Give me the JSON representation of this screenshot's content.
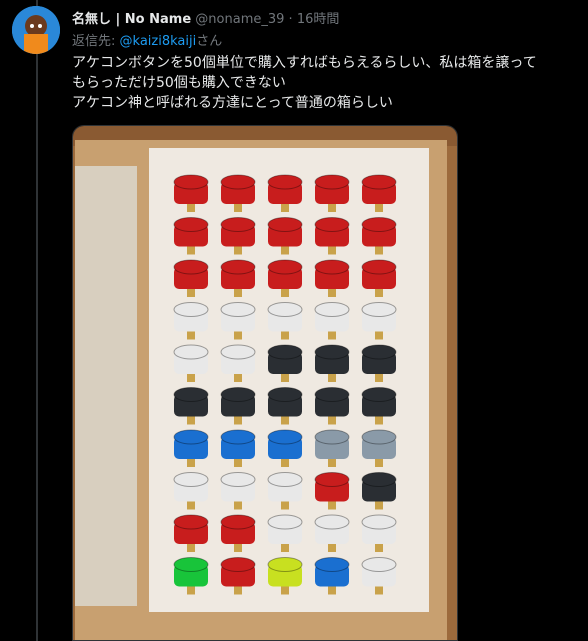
{
  "tweet": {
    "display_name": "名無し | No Name",
    "handle": "@noname_39",
    "separator": "·",
    "timestamp": "16時間",
    "reply_prefix": "返信先: ",
    "reply_to": "@kaizi8kaiji",
    "reply_suffix": "さん",
    "lines": [
      "アケコンボタンを50個単位で購入すればもらえるらしい、私は箱を譲って",
      "もらっただけ50個も購入できない",
      "アケコン神と呼ばれる方達にとって普通の箱らしい"
    ]
  },
  "photo": {
    "rows": [
      [
        "red",
        "red",
        "red",
        "red",
        "red"
      ],
      [
        "red",
        "red",
        "red",
        "red",
        "red"
      ],
      [
        "red",
        "red",
        "red",
        "red",
        "red"
      ],
      [
        "white",
        "white",
        "white",
        "white",
        "white"
      ],
      [
        "white",
        "white",
        "black",
        "black",
        "black"
      ],
      [
        "black",
        "black",
        "black",
        "black",
        "black"
      ],
      [
        "blue",
        "blue",
        "blue",
        "clear",
        "clear"
      ],
      [
        "white",
        "white",
        "white",
        "red",
        "black"
      ],
      [
        "red",
        "red",
        "white",
        "white",
        "white"
      ],
      [
        "green",
        "red",
        "yellow",
        "blue",
        "white"
      ]
    ],
    "colors": {
      "red": "#c81d1d",
      "white": "#e8e8e8",
      "black": "#2a2e33",
      "blue": "#1a6fd0",
      "clear": "#8a9aa8",
      "green": "#18c43a",
      "yellow": "#c8e020"
    }
  }
}
